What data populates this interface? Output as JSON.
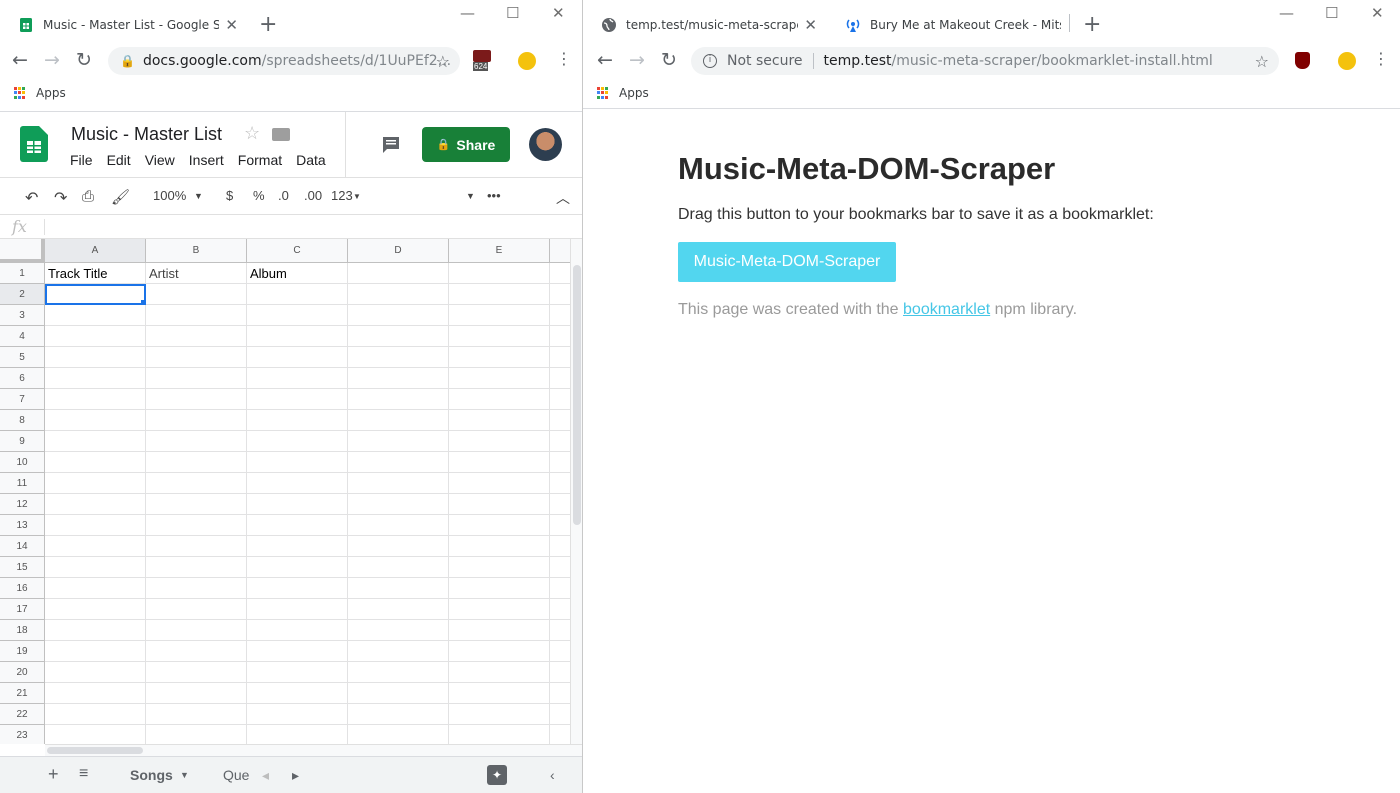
{
  "left_window": {
    "tab_title": "Music - Master List - Google She",
    "omnibox_url_host": "docs.google.com",
    "omnibox_url_path": "/spreadsheets/d/1UuPEf2...",
    "extension_badge": "624",
    "bookmarks_apps": "Apps",
    "sheet": {
      "doc_title": "Music - Master List",
      "menu": [
        "File",
        "Edit",
        "View",
        "Insert",
        "Format",
        "Data"
      ],
      "share_label": "Share",
      "zoom": "100%",
      "fmt_currency": "$",
      "fmt_percent": "%",
      "fmt_dec_less": ".0",
      "fmt_dec_more": ".00",
      "fmt_number": "123",
      "fx_label": "fx",
      "columns": [
        "A",
        "B",
        "C",
        "D",
        "E"
      ],
      "rows": [
        "1",
        "2",
        "3",
        "4",
        "5",
        "6",
        "7",
        "8",
        "9",
        "10",
        "11",
        "12",
        "13",
        "14",
        "15",
        "16",
        "17",
        "18",
        "19",
        "20",
        "21",
        "22",
        "23"
      ],
      "header_cells": [
        "Track Title",
        "Artist",
        "Album"
      ],
      "sheet_tab_active": "Songs",
      "sheet_tab_next": "Que"
    }
  },
  "right_window": {
    "tab1_title": "temp.test/music-meta-scraper/bo",
    "tab2_title": "Bury Me at Makeout Creek - Mits",
    "security_label": "Not secure",
    "url_host": "temp.test",
    "url_path": "/music-meta-scraper/bookmarklet-install.html",
    "bookmarks_apps": "Apps",
    "page": {
      "heading": "Music-Meta-DOM-Scraper",
      "intro": "Drag this button to your bookmarks bar to save it as a bookmarklet:",
      "bookmarklet_button": "Music-Meta-DOM-Scraper",
      "credit_before": "This page was created with the ",
      "credit_link": "bookmarklet",
      "credit_after": " npm library."
    }
  }
}
